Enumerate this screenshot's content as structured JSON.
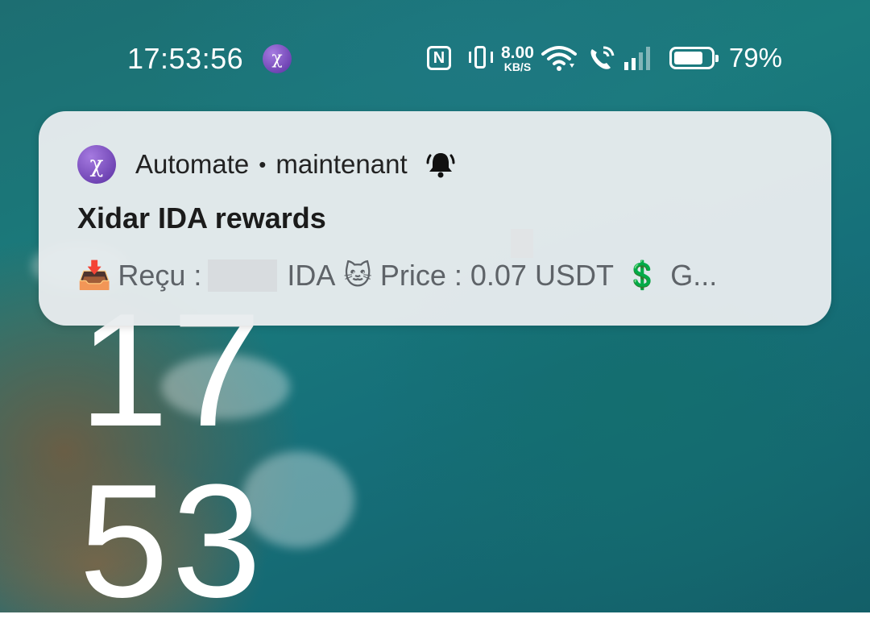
{
  "status_bar": {
    "time": "17:53:56",
    "app_icon": "automate-icon",
    "nfc_label": "N",
    "net_speed_value": "8.00",
    "net_speed_unit": "KB/S",
    "battery_percent": "79%",
    "battery_level": 0.79,
    "icons": [
      "nfc-icon",
      "vibrate-icon",
      "wifi-icon",
      "wifi-call-icon",
      "signal-icon",
      "battery-icon"
    ]
  },
  "notification": {
    "app_icon_glyph": "χ",
    "app_name": "Automate",
    "separator": "•",
    "time_ago": "maintenant",
    "title": "Xidar IDA rewards",
    "body": {
      "inbox_emoji": "📥",
      "received_label": "Reçu :",
      "ida_label": "IDA",
      "cat_emoji": "🐱",
      "price_label": "Price : 0.07 USDT",
      "dollar_emoji": "💲",
      "trailing": "G..."
    }
  },
  "lock_screen": {
    "hour": "17",
    "minute": "53"
  },
  "colors": {
    "notification_bg": "#e8ecee",
    "app_icon_purple": "#6b3bb5",
    "ocean": "#1a7b7c"
  }
}
